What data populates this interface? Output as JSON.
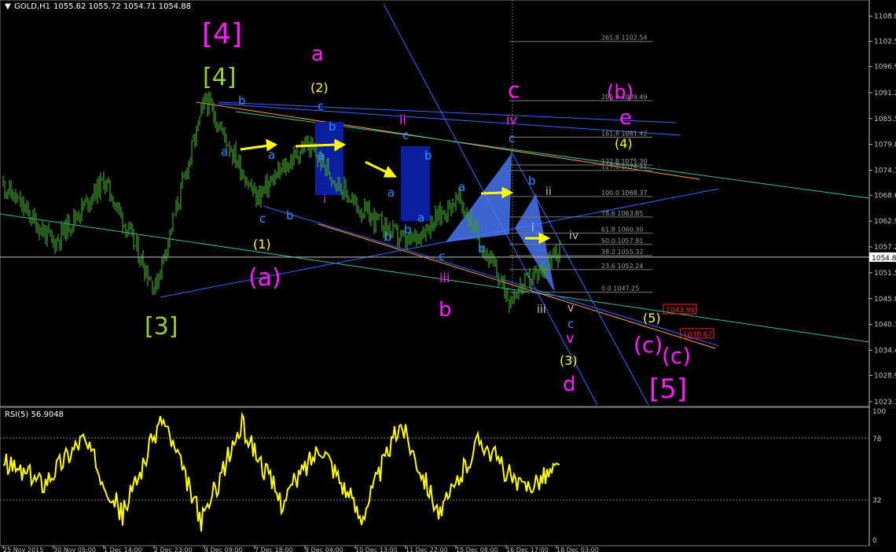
{
  "header": {
    "symbol": "GOLD,H1",
    "ohlc": "1055.62 1055.72 1054.71 1054.88",
    "indicator": "RSI(5) 56.9048"
  },
  "colors": {
    "background": "#000000",
    "candle": "#3f9b2d",
    "axis": "#c0c0c0",
    "rsi": "#ffff00",
    "magenta": "#ff1dff",
    "green_label": "#9acd32",
    "blue_label": "#2e8bff",
    "yellow_label": "#ffff00",
    "roman": "#c0c0c0",
    "fib": "#9a9a9a",
    "marker_red": "#ff2020"
  },
  "chart_data": [
    {
      "type": "line",
      "title": "GOLD,H1",
      "series": [
        {
          "name": "GOLD,H1",
          "x": [
            "25 Nov 2015",
            "30 Nov 05:00",
            "1 Dec 14:00",
            "2 Dec 23:00",
            "4 Dec 09:00",
            "7 Dec 18:00",
            "9 Dec 04:00",
            "10 Dec 13:00",
            "11 Dec 22:00",
            "15 Dec 08:00",
            "16 Dec 17:00",
            "18 Dec 03:00"
          ],
          "values": [
            1071,
            1058,
            1072,
            1048,
            1090,
            1068,
            1080,
            1066,
            1058,
            1068,
            1046,
            1056
          ]
        }
      ],
      "ylim": [
        1023.1,
        1108.9
      ],
      "y_ticks": [
        "1108.09",
        "1102.54",
        "1096.99",
        "1091.24",
        "1085.54",
        "1079.84",
        "1074.14",
        "1068.64",
        "1062.94",
        "1057.24",
        "1054.88",
        "1051.54",
        "1045.84",
        "1040.14",
        "1034.44",
        "1028.94",
        "1023.14"
      ],
      "fib_levels": [
        {
          "label": "261.8 1102.54",
          "value": 1102.54
        },
        {
          "label": "200.0 1089.49",
          "value": 1089.49
        },
        {
          "label": "161.8 1081.42",
          "value": 1081.42
        },
        {
          "label": "132.8 1075.30",
          "value": 1075.3
        },
        {
          "label": "127.2 1074.11",
          "value": 1074.11
        },
        {
          "label": "100.0 1068.37",
          "value": 1068.37
        },
        {
          "label": "78.6 1063.85",
          "value": 1063.85
        },
        {
          "label": "61.8 1060.30",
          "value": 1060.3
        },
        {
          "label": "50.0 1057.81",
          "value": 1057.81
        },
        {
          "label": "38.2 1055.32",
          "value": 1055.32
        },
        {
          "label": "23.6 1052.24",
          "value": 1052.24
        },
        {
          "label": "0.0 1047.25",
          "value": 1047.25
        }
      ],
      "price_markers": [
        "1043.99",
        "1038.67"
      ],
      "wave_labels": {
        "magenta": [
          "[4]",
          "a",
          "c",
          "(b)",
          "e",
          "(a)",
          "b",
          "d",
          "(c)",
          "(c)",
          "[5]",
          "ii",
          "iii",
          "iv",
          "v",
          "i"
        ],
        "green": [
          "[4]",
          "[3]"
        ],
        "yellow": [
          "(2)",
          "(1)",
          "(4)",
          "(5)",
          "(3)"
        ],
        "blue": [
          "b",
          "a",
          "c",
          "a",
          "c",
          "b",
          "b",
          "a",
          "b",
          "c",
          "b",
          "a",
          "a",
          "b",
          "c",
          "b",
          "c",
          "b",
          "a",
          "c"
        ],
        "white": [
          "ii",
          "iv",
          "iii",
          "v",
          "i"
        ]
      }
    },
    {
      "type": "line",
      "title": "RSI(5) 56.9048",
      "series": [
        {
          "name": "RSI(5) 56.9048",
          "values": [
            60,
            45,
            80,
            20,
            96,
            15,
            90,
            30,
            75,
            18,
            92,
            20,
            80,
            40,
            57
          ]
        }
      ],
      "ylim": [
        0,
        100
      ],
      "y_ticks": [
        "100",
        "78",
        "32",
        "0"
      ]
    }
  ]
}
